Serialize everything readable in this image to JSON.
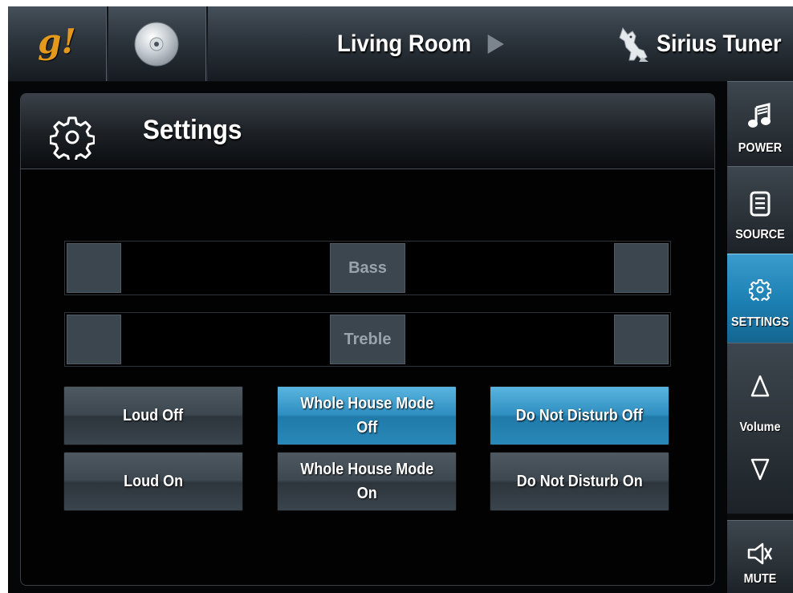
{
  "topbar": {
    "logo_text": "g!",
    "disc_icon": "disc-icon",
    "room": "Living Room",
    "tuner": "Sirius Tuner",
    "tuner_icon": "sirius-dog-icon"
  },
  "panel": {
    "title": "Settings",
    "title_icon": "gear-icon"
  },
  "sliders": [
    {
      "label": "Bass"
    },
    {
      "label": "Treble"
    }
  ],
  "buttons": {
    "loud_off": "Loud Off",
    "loud_on": "Loud On",
    "whole_house_off": "Whole House Mode\nOff",
    "whole_house_on": "Whole House Mode\nOn",
    "dnd_off": "Do Not Disturb Off",
    "dnd_on": "Do Not Disturb On"
  },
  "sidebar": {
    "power": "POWER",
    "source": "SOURCE",
    "settings": "SETTINGS",
    "volume": "Volume",
    "mute": "MUTE"
  },
  "colors": {
    "accent": "#2f8fc0",
    "logo": "#e39a1c",
    "button_default": "#3d474f"
  }
}
